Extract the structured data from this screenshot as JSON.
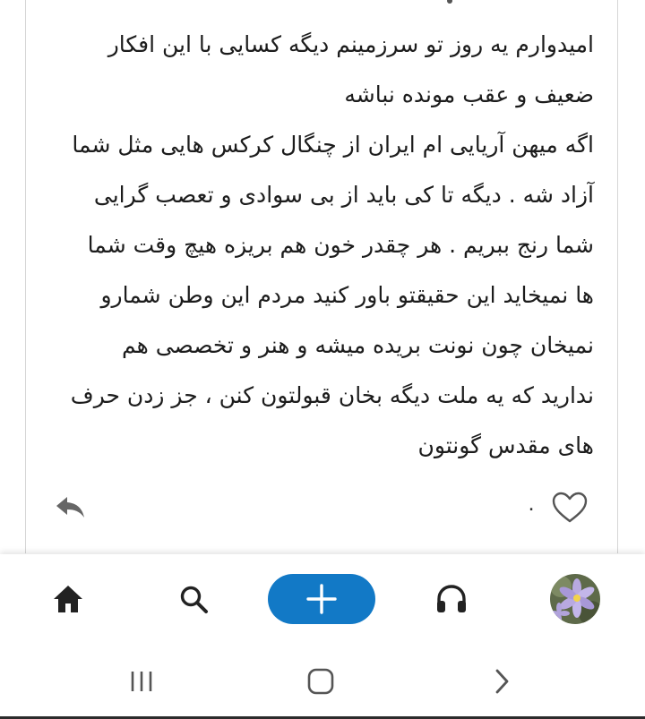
{
  "comment": {
    "lines": [
      "امیدوارم یه روز تو سرزمینم دیگه کسایی با این افکار",
      "ضعیف و عقب مونده نباشه",
      "اگه میهن آریایی ام ایران از چنگال کرکس هایی مثل شما",
      "آزاد شه . دیگه تا کی باید از بی سوادی و تعصب گرایی",
      "شما رنج ببریم . هر چقدر خون هم بریزه هیچ وقت شما",
      "ها نمیخاید این حقیقتو باور کنید مردم این وطن شمارو",
      "نمیخان چون نونت بریده میشه و هنر و تخصصی هم",
      "ندارید که یه ملت دیگه بخان قبولتون کنن ، جز زدن حرف",
      "های مقدس گونتون"
    ],
    "like_count": "۰",
    "icons": {
      "reply": "reply-icon",
      "like": "heart-icon"
    }
  },
  "app_nav": {
    "items": [
      "home-icon",
      "search-icon",
      "add-icon",
      "headphones-icon",
      "avatar"
    ],
    "accent_color": "#1279c6"
  },
  "system_nav": {
    "items": [
      "recents-icon",
      "home-icon",
      "back-icon"
    ]
  }
}
